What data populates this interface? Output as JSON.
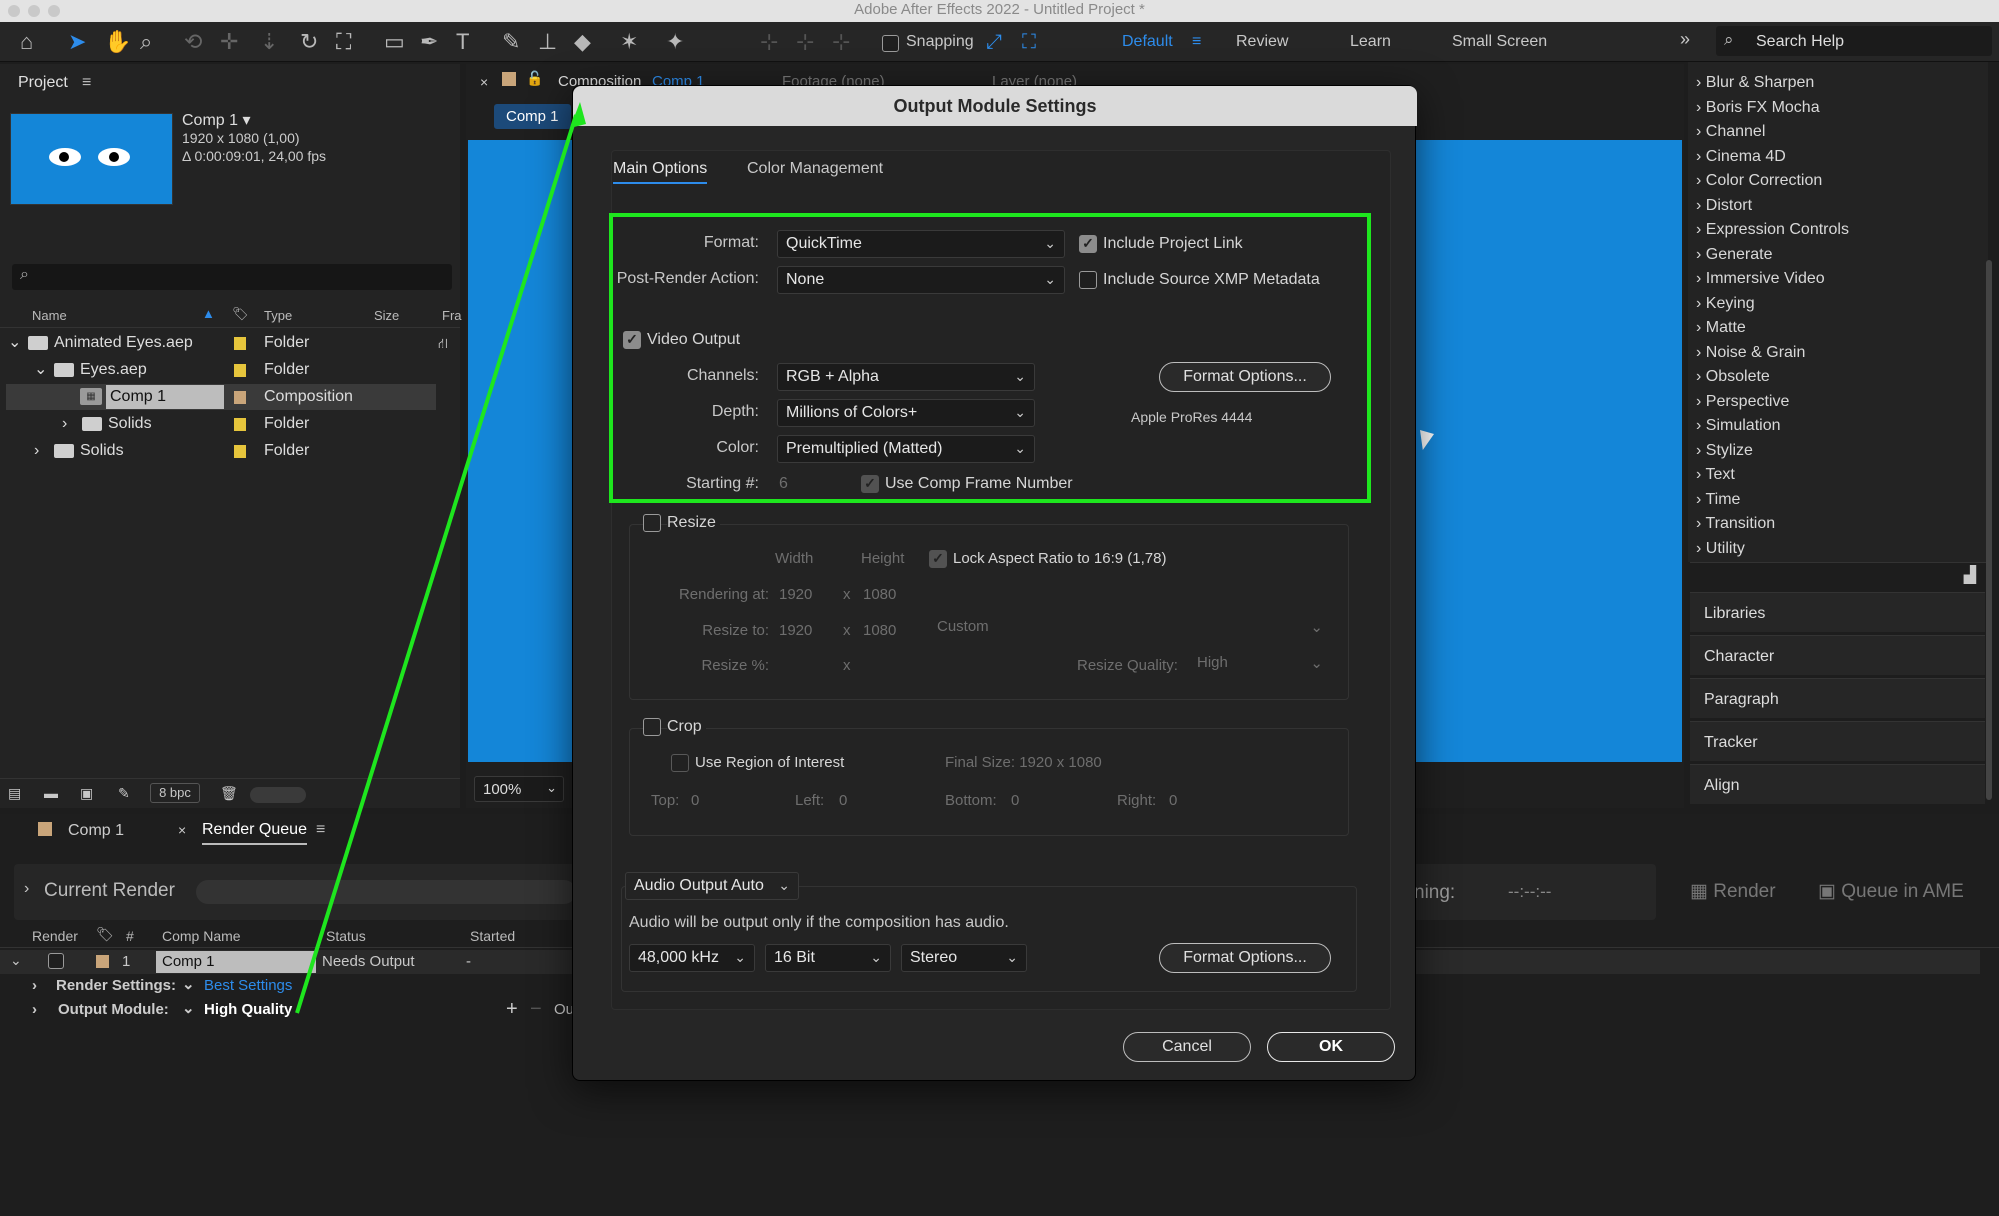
{
  "app_title": "Adobe After Effects 2022 - Untitled Project *",
  "toolbar": {
    "snapping": "Snapping",
    "workspaces": [
      "Default",
      "Review",
      "Learn",
      "Small Screen"
    ],
    "search_placeholder": "Search Help"
  },
  "project": {
    "title": "Project",
    "comp_name": "Comp 1 ▾",
    "comp_size": "1920 x 1080 (1,00)",
    "comp_duration": "Δ 0:00:09:01, 24,00 fps",
    "columns": {
      "name": "Name",
      "type": "Type",
      "size": "Size",
      "frame": "Fra"
    },
    "items": [
      {
        "name": "Animated Eyes.aep",
        "type": "Folder",
        "arrow": "⌄",
        "color": "#e6c53c"
      },
      {
        "name": "Eyes.aep",
        "type": "Folder",
        "arrow": "⌄",
        "color": "#e6c53c"
      },
      {
        "name": "Comp 1",
        "type": "Composition",
        "arrow": "",
        "color": "#c9a57a"
      },
      {
        "name": "Solids",
        "type": "Folder",
        "arrow": "›",
        "color": "#e6c53c"
      },
      {
        "name": "Solids",
        "type": "Folder",
        "arrow": "›",
        "color": "#e6c53c"
      }
    ],
    "bpc": "8 bpc"
  },
  "viewer": {
    "tab_composition": "Composition",
    "tab_comp_link": "Comp 1",
    "footage": "Footage (none)",
    "layer": "Layer (none)",
    "tab_comp1": "Comp 1",
    "zoom": "100%"
  },
  "effects": [
    "Blur & Sharpen",
    "Boris FX Mocha",
    "Channel",
    "Cinema 4D",
    "Color Correction",
    "Distort",
    "Expression Controls",
    "Generate",
    "Immersive Video",
    "Keying",
    "Matte",
    "Noise & Grain",
    "Obsolete",
    "Perspective",
    "Simulation",
    "Stylize",
    "Text",
    "Time",
    "Transition",
    "Utility"
  ],
  "right_panels": [
    "Libraries",
    "Character",
    "Paragraph",
    "Tracker",
    "Align"
  ],
  "render_queue": {
    "tab_comp": "Comp 1",
    "tab_rq": "Render Queue",
    "current_render": "Current Render",
    "remaining_label": "ning:",
    "remaining_value": "--:--:--",
    "render_btn": "Render",
    "queue_ame": "Queue in AME",
    "columns": {
      "render": "Render",
      "num": "#",
      "comp": "Comp Name",
      "status": "Status",
      "started": "Started"
    },
    "item": {
      "num": "1",
      "comp": "Comp 1",
      "status": "Needs Output",
      "started": "-"
    },
    "render_settings_label": "Render Settings:",
    "render_settings_value": "Best Settings",
    "output_module_label": "Output Module:",
    "output_module_value": "High Quality",
    "output_to_trunc": "Ou"
  },
  "dialog": {
    "title": "Output Module Settings",
    "tabs": [
      "Main Options",
      "Color Management"
    ],
    "format_label": "Format:",
    "format_value": "QuickTime",
    "post_render_label": "Post-Render Action:",
    "post_render_value": "None",
    "include_project_link": "Include Project Link",
    "include_xmp": "Include Source XMP Metadata",
    "video_output": "Video Output",
    "channels_label": "Channels:",
    "channels_value": "RGB + Alpha",
    "depth_label": "Depth:",
    "depth_value": "Millions of Colors+",
    "color_label": "Color:",
    "color_value": "Premultiplied (Matted)",
    "format_options": "Format Options...",
    "codec": "Apple ProRes 4444",
    "starting_label": "Starting #:",
    "starting_value": "6",
    "use_comp_frame": "Use Comp Frame Number",
    "resize": "Resize",
    "width": "Width",
    "height": "Height",
    "lock_aspect": "Lock Aspect Ratio to 16:9 (1,78)",
    "rendering_at": "Rendering at:",
    "rw": "1920",
    "rh": "1080",
    "x": "x",
    "resize_to": "Resize to:",
    "tw": "1920",
    "th": "1080",
    "custom": "Custom",
    "resize_pct": "Resize %:",
    "resize_quality": "Resize Quality:",
    "quality": "High",
    "crop": "Crop",
    "use_roi": "Use Region of Interest",
    "final_size": "Final Size: 1920 x 1080",
    "top": "Top:",
    "top_v": "0",
    "left": "Left:",
    "left_v": "0",
    "bottom": "Bottom:",
    "bottom_v": "0",
    "right": "Right:",
    "right_v": "0",
    "audio_output": "Audio Output Auto",
    "audio_note": "Audio will be output only if the composition has audio.",
    "sample_rate": "48,000 kHz",
    "bit_depth": "16 Bit",
    "channels_audio": "Stereo",
    "audio_format_options": "Format Options...",
    "cancel": "Cancel",
    "ok": "OK"
  },
  "colors": {
    "accent": "#2d8ceb",
    "highlight": "#1ee61e",
    "comp_bg": "#1486d8"
  }
}
